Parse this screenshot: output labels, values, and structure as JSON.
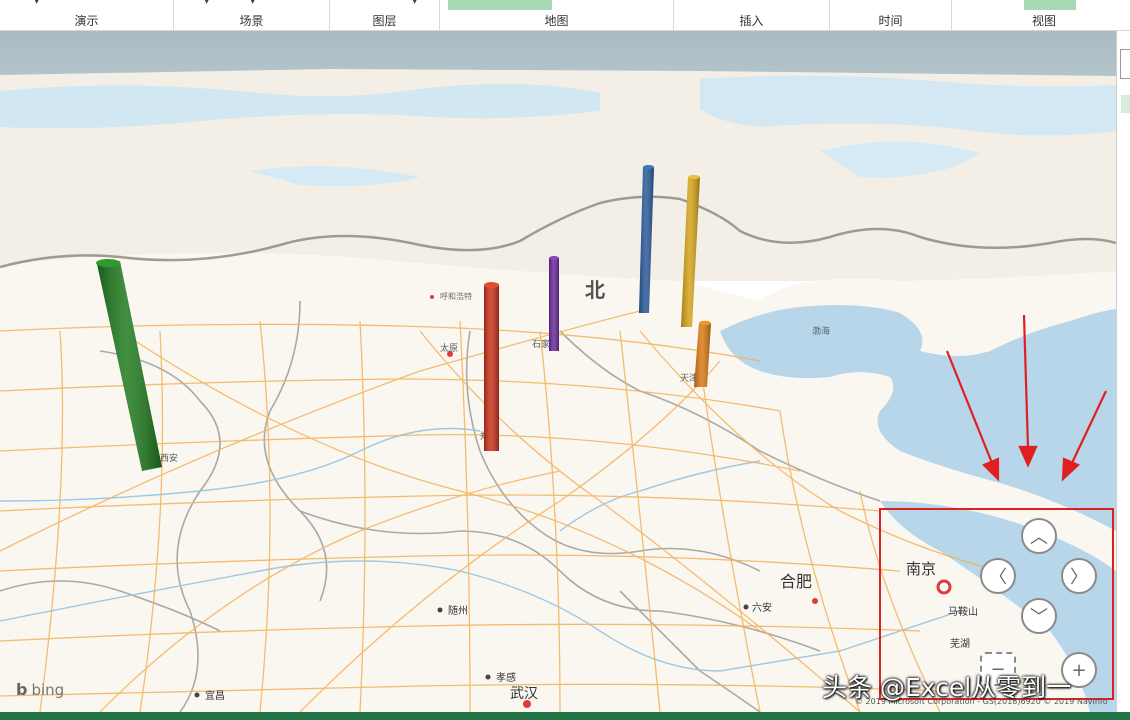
{
  "ribbon": {
    "groups": [
      {
        "label": "演示"
      },
      {
        "label": "场景"
      },
      {
        "label": "图层"
      },
      {
        "label": "地图"
      },
      {
        "label": "插入"
      },
      {
        "label": "时间"
      },
      {
        "label": "视图"
      }
    ]
  },
  "map": {
    "cities": [
      {
        "label": "合肥"
      },
      {
        "label": "南京"
      },
      {
        "label": "武汉"
      },
      {
        "label": "六安"
      },
      {
        "label": "随州"
      },
      {
        "label": "孝感"
      },
      {
        "label": "宜昌"
      },
      {
        "label": "马鞍山"
      },
      {
        "label": "芜湖"
      },
      {
        "label": "北"
      },
      {
        "label": "太原"
      },
      {
        "label": "石家庄"
      },
      {
        "label": "郑州"
      },
      {
        "label": "西安"
      },
      {
        "label": "天津"
      },
      {
        "label": "渤海"
      },
      {
        "label": "呼和浩特"
      }
    ],
    "columns": [
      {
        "color": "#1f7a1f"
      },
      {
        "color": "#c8321c"
      },
      {
        "color": "#6a2a9a"
      },
      {
        "color": "#2a5a9a"
      },
      {
        "color": "#d4a419"
      },
      {
        "color": "#d97a14"
      }
    ]
  },
  "nav": {
    "up_icon": "chevron-up-icon",
    "left_icon": "chevron-left-icon",
    "right_icon": "chevron-right-icon",
    "down_icon": "chevron-down-icon"
  },
  "branding": {
    "bing": "bing",
    "copyright": "© 2019 Microsoft Corporation - GS(2018)6920  © 2019 NavInfo",
    "watermark": "头条 @Excel从零到一"
  }
}
